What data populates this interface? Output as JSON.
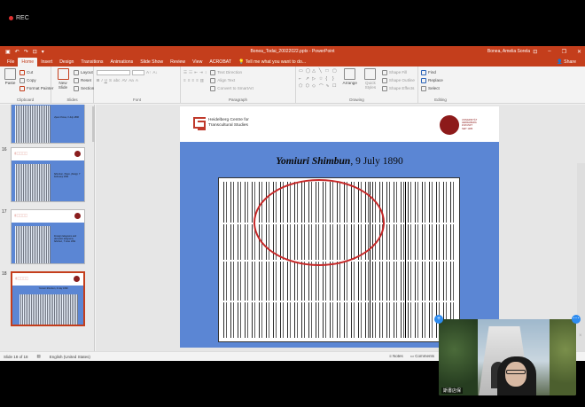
{
  "recording": {
    "label": "REC"
  },
  "window": {
    "title": "Bonea_Todai_20022022.pptx - PowerPoint",
    "user": "Bonea, Amelia Sorela"
  },
  "tabs": [
    "File",
    "Home",
    "Insert",
    "Design",
    "Transitions",
    "Animations",
    "Slide Show",
    "Review",
    "View",
    "ACROBAT"
  ],
  "active_tab": "Home",
  "tell_me": "Tell me what you want to do...",
  "share_label": "Share",
  "ribbon": {
    "clipboard": {
      "paste": "Paste",
      "cut": "Cut",
      "copy": "Copy",
      "format_painter": "Format Painter",
      "group": "Clipboard"
    },
    "slides": {
      "new_slide": "New Slide",
      "layout": "Layout",
      "reset": "Reset",
      "section": "Section",
      "group": "Slides"
    },
    "font": {
      "group": "Font"
    },
    "paragraph": {
      "text_direction": "Text Direction",
      "align_text": "Align Text",
      "convert": "Convert to SmartArt",
      "group": "Paragraph"
    },
    "drawing": {
      "arrange": "Arrange",
      "quick_styles": "Quick Styles",
      "shape_fill": "Shape Fill",
      "shape_outline": "Shape Outline",
      "shape_effects": "Shape Effects",
      "group": "Drawing"
    },
    "editing": {
      "find": "Find",
      "replace": "Replace",
      "select": "Select",
      "group": "Editing"
    }
  },
  "thumbnails": [
    {
      "num": "",
      "caption": "Jiyuu Chosa, 3 July 1890",
      "selected": false
    },
    {
      "num": "16",
      "caption": "Shimbun, Tokyo, (Kanji), 7 February 1891",
      "selected": false
    },
    {
      "num": "17",
      "caption": "Foreign telegrams and domestic telegrams, Shinbun, 7 June 1891",
      "selected": false
    },
    {
      "num": "18",
      "caption": "Yomiuri Shimbun, 9 July 1890",
      "selected": true
    }
  ],
  "slide": {
    "org_line1": "Heidelberg Centre for",
    "org_line2": "Transcultural Studies",
    "univ_line1": "UNIVERSITÄT",
    "univ_line2": "HEIDELBERG",
    "univ_line3": "ZUKUNFT",
    "univ_line4": "SEIT 1386",
    "title_italic": "Yomiuri Shimbun",
    "title_rest": ", 9 July 1890"
  },
  "status": {
    "slide_info": "Slide 18 of 18",
    "language": "English (United States)",
    "notes": "Notes",
    "comments": "Comments"
  },
  "video": {
    "name": "斯書店保"
  },
  "colors": {
    "brand": "#c43e1c",
    "slide_blue": "#5b86d4",
    "annotation": "#c62828",
    "seal": "#8d1a1a"
  }
}
